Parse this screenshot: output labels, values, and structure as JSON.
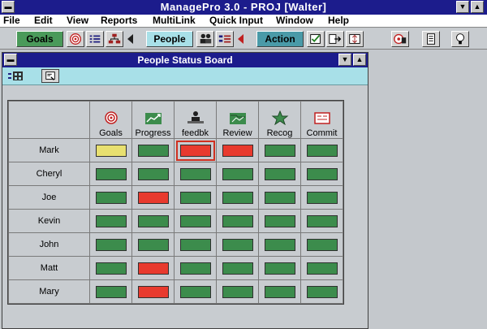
{
  "app": {
    "title": "ManagePro 3.0 - PROJ [Walter]"
  },
  "menu": [
    {
      "label": "File",
      "key": "file"
    },
    {
      "label": "Edit",
      "key": "edit"
    },
    {
      "label": "View",
      "key": "view"
    },
    {
      "label": "Reports",
      "key": "reports"
    },
    {
      "label": "MultiLink",
      "key": "multilink"
    },
    {
      "label": "Quick Input",
      "key": "quick-input"
    },
    {
      "label": "Window",
      "key": "window"
    },
    {
      "label": "Help",
      "key": "help"
    }
  ],
  "toolbar": {
    "goals_label": "Goals",
    "people_label": "People",
    "action_label": "Action"
  },
  "colors": {
    "titlebar": "#1c1c8c",
    "goals_group": "#4a9a5a",
    "people_group": "#a8e0e8",
    "action_group": "#4a9aa8",
    "status_green": "#3c8c4c",
    "status_red": "#e83a2e",
    "status_yellow": "#e8e070",
    "child_toolbar": "#a8e0e8"
  },
  "board": {
    "title": "People Status Board",
    "columns": [
      {
        "label": "Goals",
        "icon": "target-icon"
      },
      {
        "label": "Progress",
        "icon": "progress-chart-icon"
      },
      {
        "label": "feedbk",
        "icon": "feedback-people-icon"
      },
      {
        "label": "Review",
        "icon": "review-icon"
      },
      {
        "label": "Recog",
        "icon": "star-recognition-icon"
      },
      {
        "label": "Commit",
        "icon": "commit-icon"
      }
    ],
    "rows": [
      {
        "name": "Mark",
        "status": [
          "yellow",
          "green",
          "red",
          "red",
          "green",
          "green"
        ]
      },
      {
        "name": "Cheryl",
        "status": [
          "green",
          "green",
          "green",
          "green",
          "green",
          "green"
        ]
      },
      {
        "name": "Joe",
        "status": [
          "green",
          "red",
          "green",
          "green",
          "green",
          "green"
        ]
      },
      {
        "name": "Kevin",
        "status": [
          "green",
          "green",
          "green",
          "green",
          "green",
          "green"
        ]
      },
      {
        "name": "John",
        "status": [
          "green",
          "green",
          "green",
          "green",
          "green",
          "green"
        ]
      },
      {
        "name": "Matt",
        "status": [
          "green",
          "red",
          "green",
          "green",
          "green",
          "green"
        ]
      },
      {
        "name": "Mary",
        "status": [
          "green",
          "red",
          "green",
          "green",
          "green",
          "green"
        ]
      }
    ],
    "selected": {
      "row": 0,
      "col": 2
    }
  }
}
